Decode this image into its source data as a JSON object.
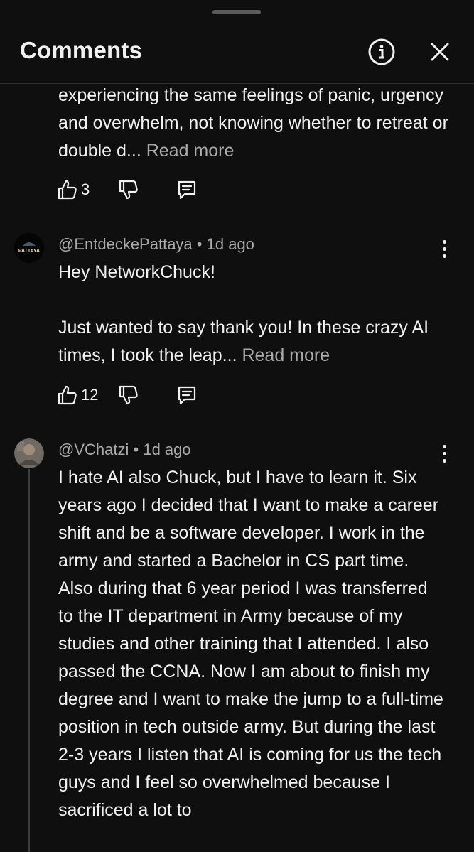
{
  "header": {
    "title": "Comments",
    "info_icon": "info-icon",
    "close_icon": "close-icon"
  },
  "comments": [
    {
      "text": "experiencing the same feelings of panic, urgency and overwhelm, not knowing whether to retreat or double d...",
      "read_more": "Read more",
      "likes": "3"
    },
    {
      "author": "@EntdeckePattaya",
      "age": "1d ago",
      "avatar_text": "PATTAYA",
      "text": "Hey NetworkChuck!\n\nJust wanted to say thank you! In these crazy AI times, I took the leap...",
      "read_more": "Read more",
      "likes": "12"
    },
    {
      "author": "@VChatzi",
      "age": "1d ago",
      "text": "I hate AI also Chuck, but I have to learn it. Six years ago I decided that I want to make a career shift and be a software developer. I work in the army and started a Bachelor in CS part time. Also during that 6 year period I was transferred to the IT department in Army because of my studies and other training that I attended. I also passed the CCNA. Now I am about to finish my degree and I want to make the jump to a full-time position in tech outside army. But during the last 2-3 years I listen that AI is coming for us the tech guys and I feel so overwhelmed because I sacrificed a lot to"
    }
  ],
  "meta_separator": "•",
  "colors": {
    "background": "#0f0f0f",
    "text": "#f1f1f1",
    "secondary_text": "#aaaaaa"
  }
}
